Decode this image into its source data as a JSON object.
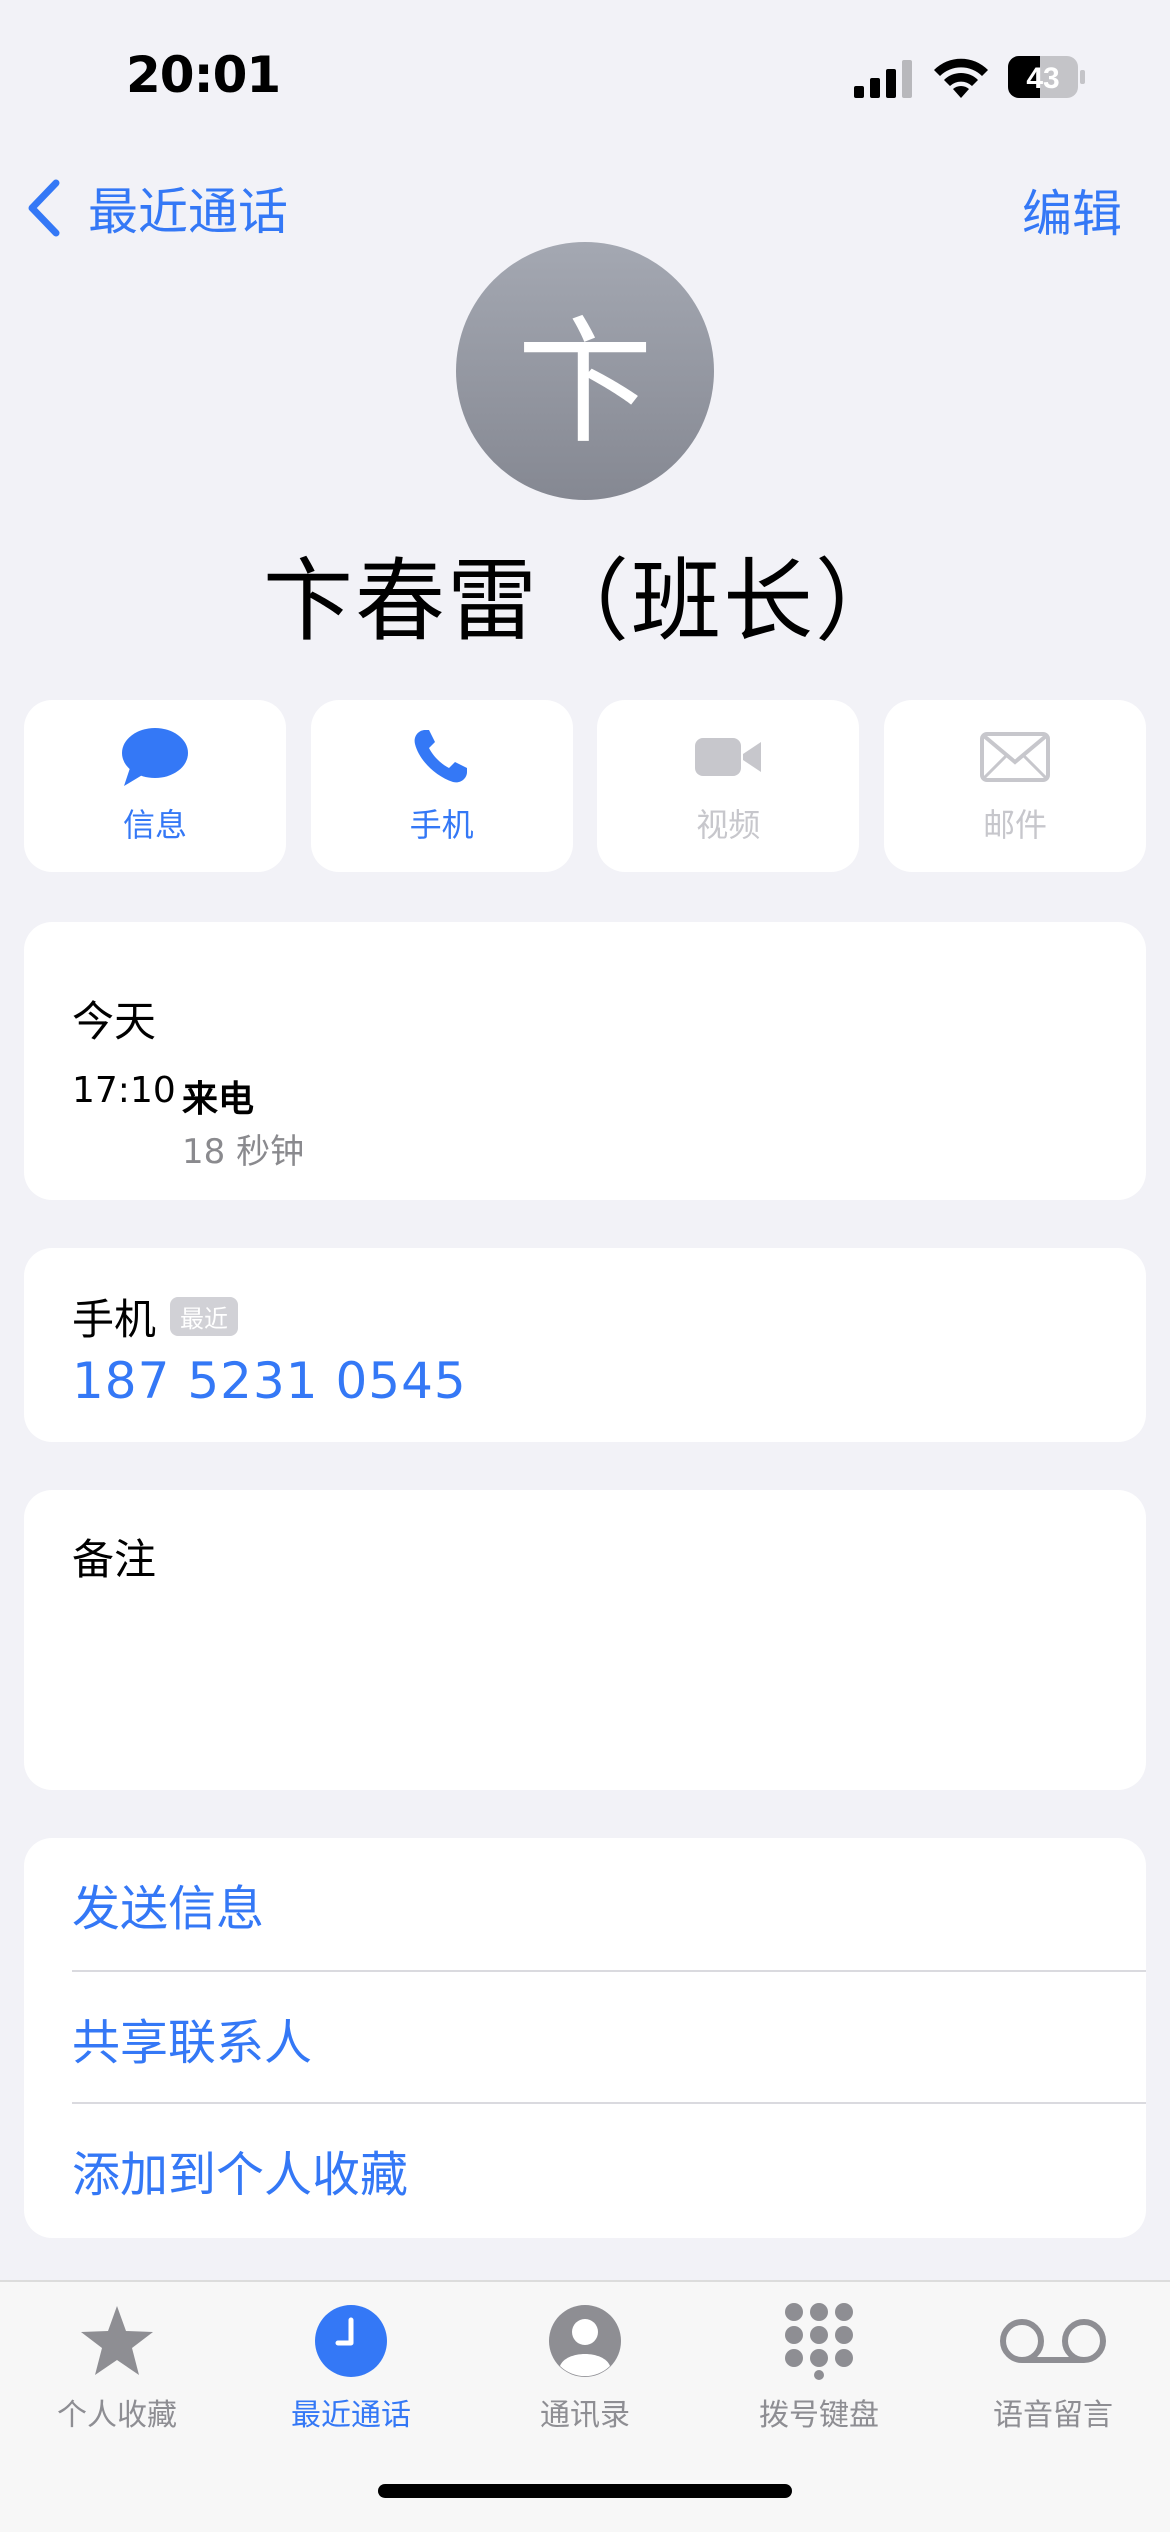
{
  "status_bar": {
    "time": "20:01",
    "battery_level": "43"
  },
  "nav": {
    "back_label": "最近通话",
    "edit_label": "编辑"
  },
  "contact": {
    "avatar_initial": "卞",
    "name": "卞春雷（班长）"
  },
  "actions": [
    {
      "label": "信息",
      "icon": "message-icon",
      "enabled": true
    },
    {
      "label": "手机",
      "icon": "phone-icon",
      "enabled": true
    },
    {
      "label": "视频",
      "icon": "video-icon",
      "enabled": false
    },
    {
      "label": "邮件",
      "icon": "mail-icon",
      "enabled": false
    }
  ],
  "recent_calls": {
    "day": "今天",
    "calls": [
      {
        "time": "17:10",
        "type": "来电",
        "duration": "18 秒钟"
      }
    ]
  },
  "phone": {
    "label": "手机",
    "badge": "最近",
    "number": "187 5231 0545"
  },
  "notes": {
    "label": "备注"
  },
  "links": [
    "发送信息",
    "共享联系人",
    "添加到个人收藏"
  ],
  "tabs": [
    {
      "label": "个人收藏",
      "icon": "star-icon",
      "active": false
    },
    {
      "label": "最近通话",
      "icon": "clock-icon",
      "active": true
    },
    {
      "label": "通讯录",
      "icon": "person-icon",
      "active": false
    },
    {
      "label": "拨号键盘",
      "icon": "keypad-icon",
      "active": false
    },
    {
      "label": "语音留言",
      "icon": "voicemail-icon",
      "active": false
    }
  ],
  "colors": {
    "accent": "#3478f6",
    "background": "#f2f2f7",
    "disabled": "#c7c7cc",
    "inactive_tab": "#8e8e93"
  }
}
